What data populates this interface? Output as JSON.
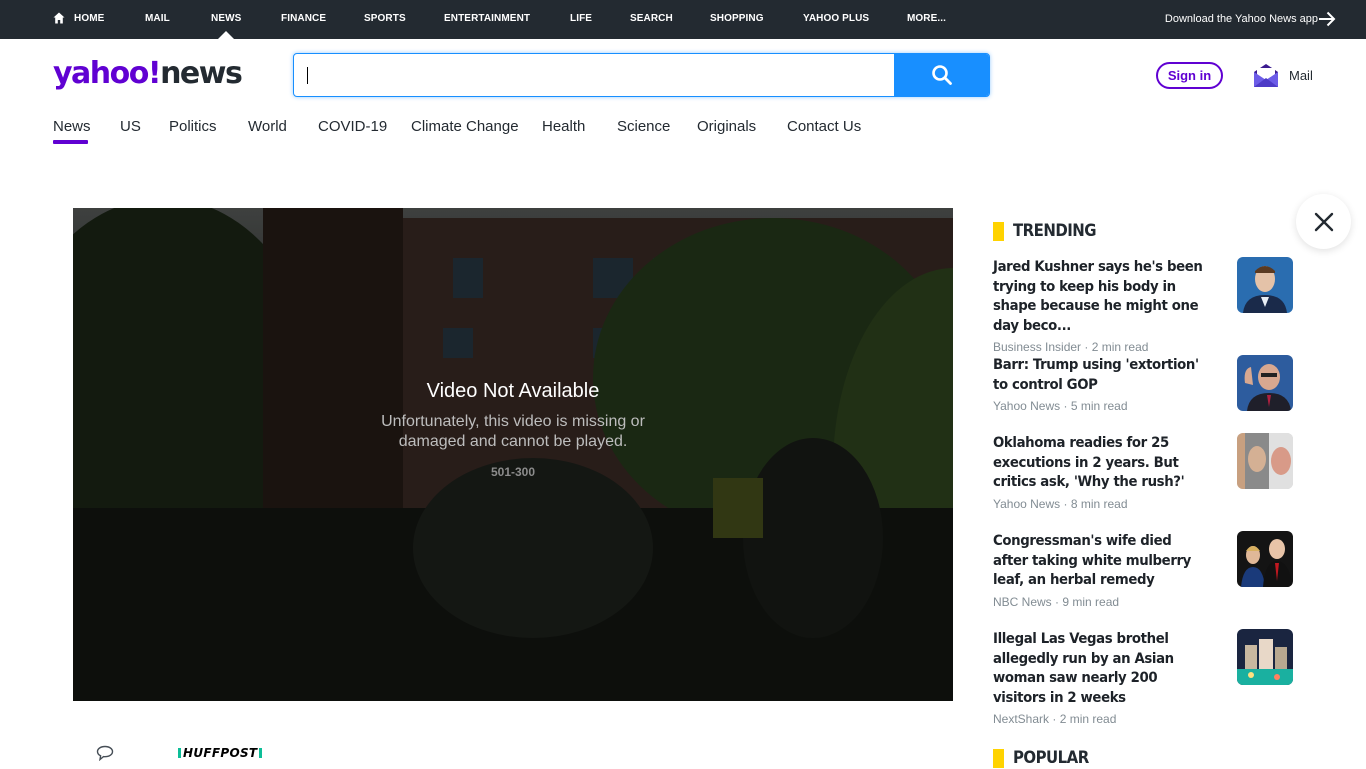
{
  "topnav": {
    "items": [
      "Home",
      "Mail",
      "News",
      "Finance",
      "Sports",
      "Entertainment",
      "Life",
      "Search",
      "Shopping",
      "Yahoo Plus",
      "More..."
    ],
    "active": "News",
    "download_label": "Download the Yahoo News app",
    "icons": {
      "home": "home-icon",
      "download": "arrow-right-icon"
    }
  },
  "header": {
    "logo_yahoo": "yahoo!",
    "logo_news": "news",
    "search": {
      "value": "",
      "placeholder": ""
    },
    "signin_label": "Sign in",
    "mail_label": "Mail"
  },
  "subnav": {
    "items": [
      "News",
      "US",
      "Politics",
      "World",
      "COVID-19",
      "Climate Change",
      "Health",
      "Science",
      "Originals",
      "Contact Us"
    ],
    "active": "News"
  },
  "video": {
    "title": "Video Not Available",
    "description": "Unfortunately, this video is missing or damaged and cannot be played.",
    "code": "501-300"
  },
  "trending": {
    "title": "TRENDING",
    "stories": [
      {
        "headline": "Jared Kushner says he's been trying to keep his body in shape because he might one day beco...",
        "source": "Business Insider",
        "read": "2 min read"
      },
      {
        "headline": "Barr: Trump using 'extortion' to control GOP",
        "source": "Yahoo News",
        "read": "5 min read"
      },
      {
        "headline": "Oklahoma readies for 25 executions in 2 years. But critics ask, 'Why the rush?'",
        "source": "Yahoo News",
        "read": "8 min read"
      },
      {
        "headline": "Congressman's wife died after taking white mulberry leaf, an herbal remedy",
        "source": "NBC News",
        "read": "9 min read"
      },
      {
        "headline": "Illegal Las Vegas brothel allegedly run by an Asian woman saw nearly 200 visitors in 2 weeks",
        "source": "NextShark",
        "read": "2 min read"
      }
    ]
  },
  "popular": {
    "title": "POPULAR"
  },
  "article": {
    "publisher": "HUFFPOST"
  },
  "colors": {
    "brand_purple": "#6001d2",
    "search_blue": "#188fff",
    "topbar_bg": "#232a31",
    "accent_yellow": "#ffd300",
    "huffpost_green": "#0dbe98"
  }
}
